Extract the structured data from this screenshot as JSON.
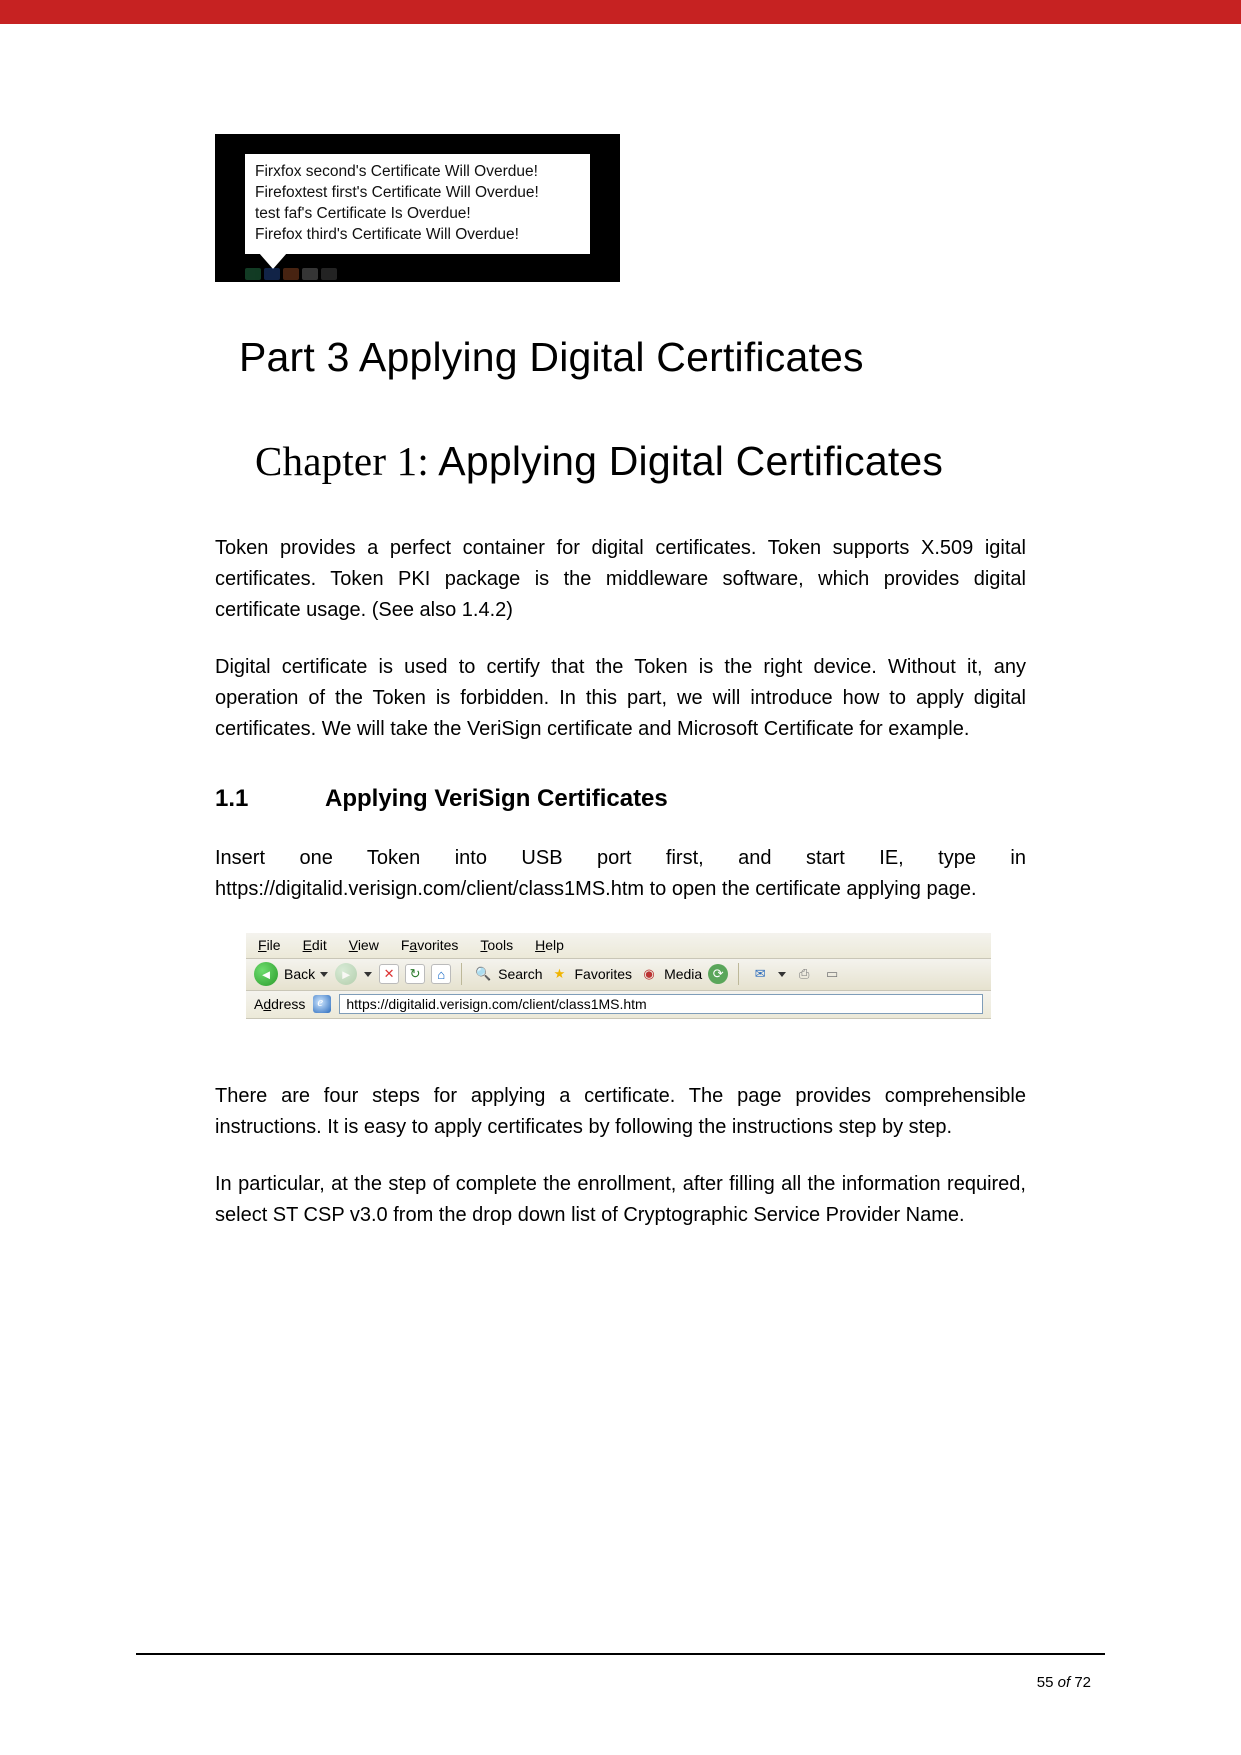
{
  "tooltip": {
    "lines": [
      "Firxfox second's Certificate Will Overdue!",
      "Firefoxtest first's Certificate Will Overdue!",
      "test faf's Certificate Is Overdue!",
      "Firefox third's Certificate Will Overdue!"
    ]
  },
  "headings": {
    "part_title": "Part 3 Applying Digital Certificates",
    "chapter_prefix": "Chapter 1:",
    "chapter_rest": " Applying Digital Certificates",
    "sec_num": "1.1",
    "sec_title": "Applying VeriSign Certificates"
  },
  "paragraphs": {
    "p1": "Token provides a perfect container for digital certificates. Token supports X.509 igital certificates. Token PKI package is the middleware software, which provides digital certificate usage. (See also 1.4.2)",
    "p2": "Digital certificate is used to certify that the Token is the right device. Without it, any operation of the Token is forbidden. In this part, we will introduce how to apply digital certificates. We will take the VeriSign certificate and Microsoft Certificate for example.",
    "p3": "Insert one Token into USB port first, and start IE, type in https://digitalid.verisign.com/client/class1MS.htm to open the certificate applying page.",
    "p4": "There are four steps for applying a certificate. The page provides comprehensible instructions. It is easy to apply certificates by following the instructions step by step.",
    "p5": "In particular, at the step of complete the enrollment, after filling all the information required, select ST CSP v3.0 from the drop down list of Cryptographic Service Provider Name."
  },
  "ie": {
    "menu": {
      "file": "File",
      "edit": "Edit",
      "view": "View",
      "favorites": "Favorites",
      "tools": "Tools",
      "help": "Help",
      "file_u": "F",
      "edit_u": "E",
      "view_u": "V",
      "fav_u": "a",
      "tools_u": "T",
      "help_u": "H"
    },
    "toolbar": {
      "back": "Back",
      "search": "Search",
      "favorites": "Favorites",
      "media": "Media"
    },
    "address_label_pre": "A",
    "address_label_u": "d",
    "address_label_post": "dress",
    "url": "https://digitalid.verisign.com/client/class1MS.htm"
  },
  "footer": {
    "page": "55",
    "of": "of",
    "total": "72"
  }
}
